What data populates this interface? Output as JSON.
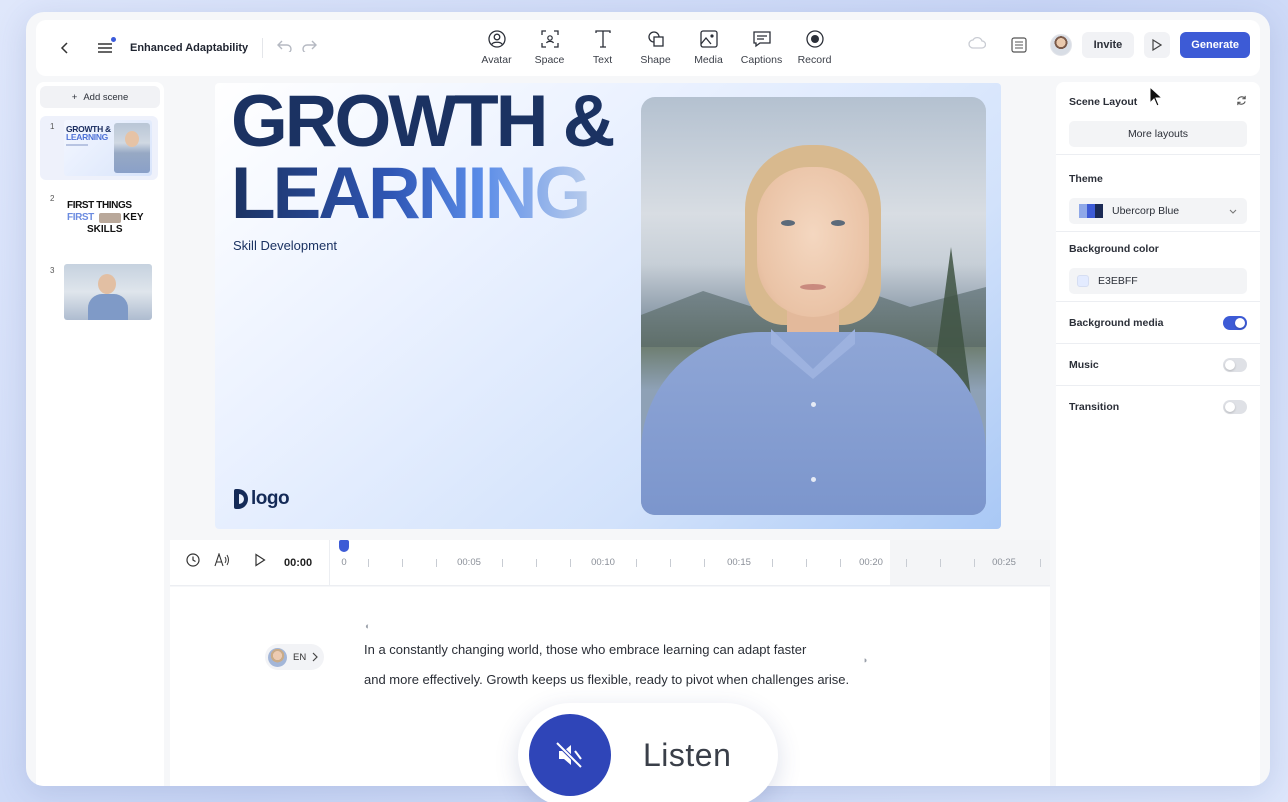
{
  "toolbar": {
    "title": "Enhanced Adaptability",
    "tools": [
      {
        "label": "Avatar",
        "icon": "avatar-icon"
      },
      {
        "label": "Space",
        "icon": "space-icon"
      },
      {
        "label": "Text",
        "icon": "text-icon"
      },
      {
        "label": "Shape",
        "icon": "shape-icon"
      },
      {
        "label": "Media",
        "icon": "media-icon"
      },
      {
        "label": "Captions",
        "icon": "captions-icon"
      },
      {
        "label": "Record",
        "icon": "record-icon"
      }
    ],
    "invite_label": "Invite",
    "generate_label": "Generate"
  },
  "scenes": {
    "add_label": "Add scene",
    "items": [
      {
        "number": "1",
        "title_line1": "GROWTH &",
        "title_line2": "LEARNING"
      },
      {
        "number": "2",
        "line1": "FIRST THINGS",
        "line2a": "FIRST",
        "line2b": "KEY",
        "line3": "SKILLS"
      },
      {
        "number": "3"
      }
    ]
  },
  "slide": {
    "title_line1": "GROWTH &",
    "title_line2": "LEARNING",
    "subtitle": "Skill Development",
    "logo": "logo"
  },
  "timeline": {
    "current_time": "00:00",
    "markers": [
      "0",
      "00:05",
      "00:10",
      "00:15",
      "00:20",
      "00:25"
    ]
  },
  "script": {
    "language": "EN",
    "line1": "In a constantly changing world, those who embrace learning can adapt faster",
    "line2": "and more effectively. Growth keeps us flexible, ready to pivot when challenges arise."
  },
  "properties": {
    "scene_layout_label": "Scene Layout",
    "more_layouts_label": "More layouts",
    "theme_label": "Theme",
    "theme_value": "Ubercorp Blue",
    "bg_color_label": "Background color",
    "bg_color_value": "E3EBFF",
    "bg_media_label": "Background media",
    "bg_media_on": true,
    "music_label": "Music",
    "music_on": false,
    "transition_label": "Transition",
    "transition_on": false
  },
  "listen": {
    "label": "Listen"
  },
  "colors": {
    "accent": "#3d5bd6",
    "bg_color_swatch": "#E3EBFF",
    "title_dark": "#1b3262"
  }
}
